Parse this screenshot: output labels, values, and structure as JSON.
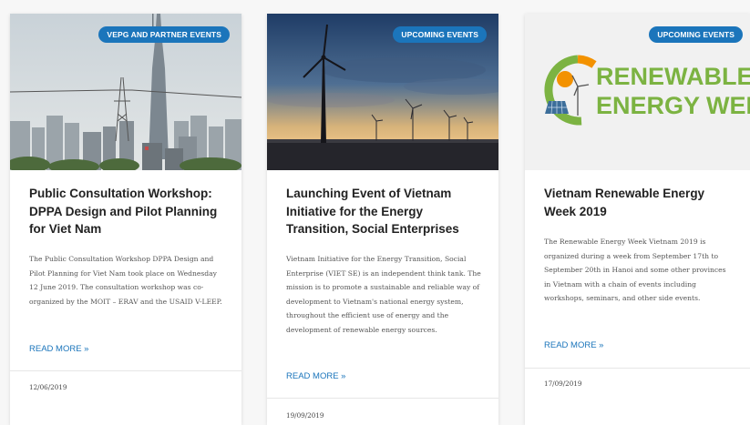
{
  "cards": [
    {
      "badge": "VEPG AND PARTNER EVENTS",
      "title": "Public Consultation Workshop: DPPA Design and Pilot Planning for Viet Nam",
      "excerpt": "The Public Consultation Workshop DPPA Design and Pilot Planning for Viet Nam took place on Wednesday 12 June 2019. The consultation workshop was co-organized by the MOIT – ERAV and the USAID V-LEEP.",
      "read_more": "READ MORE »",
      "date": "12/06/2019",
      "image": "city-skyline-photo"
    },
    {
      "badge": "UPCOMING EVENTS",
      "title": "Launching Event of Vietnam Initiative for the Energy Transition, Social Enterprises",
      "excerpt": "Vietnam Initiative for the Energy Transition, Social Enterprise (VIET SE) is an independent think tank. The mission is to promote a sustainable and reliable way of development to Vietnam's national energy system, throughout the efficient use of energy and the development of renewable energy sources.",
      "read_more": "READ MORE »",
      "date": "19/09/2019",
      "image": "wind-turbine-sunset-photo"
    },
    {
      "badge": "UPCOMING EVENTS",
      "title": "Vietnam Renewable Energy Week 2019",
      "excerpt": "The Renewable Energy Week Vietnam 2019 is organized during a week from September 17th to September 20th in Hanoi and some other provinces in Vietnam with a chain of events including workshops, seminars, and other side events.",
      "read_more": "READ MORE »",
      "date": "17/09/2019",
      "image": "renewable-energy-week-logo",
      "logo_text": [
        "RENEWABLE",
        "ENERGY WEEK"
      ]
    }
  ],
  "colors": {
    "accent": "#1b75bb",
    "logo_green": "#7cb342",
    "logo_orange": "#f39200"
  }
}
